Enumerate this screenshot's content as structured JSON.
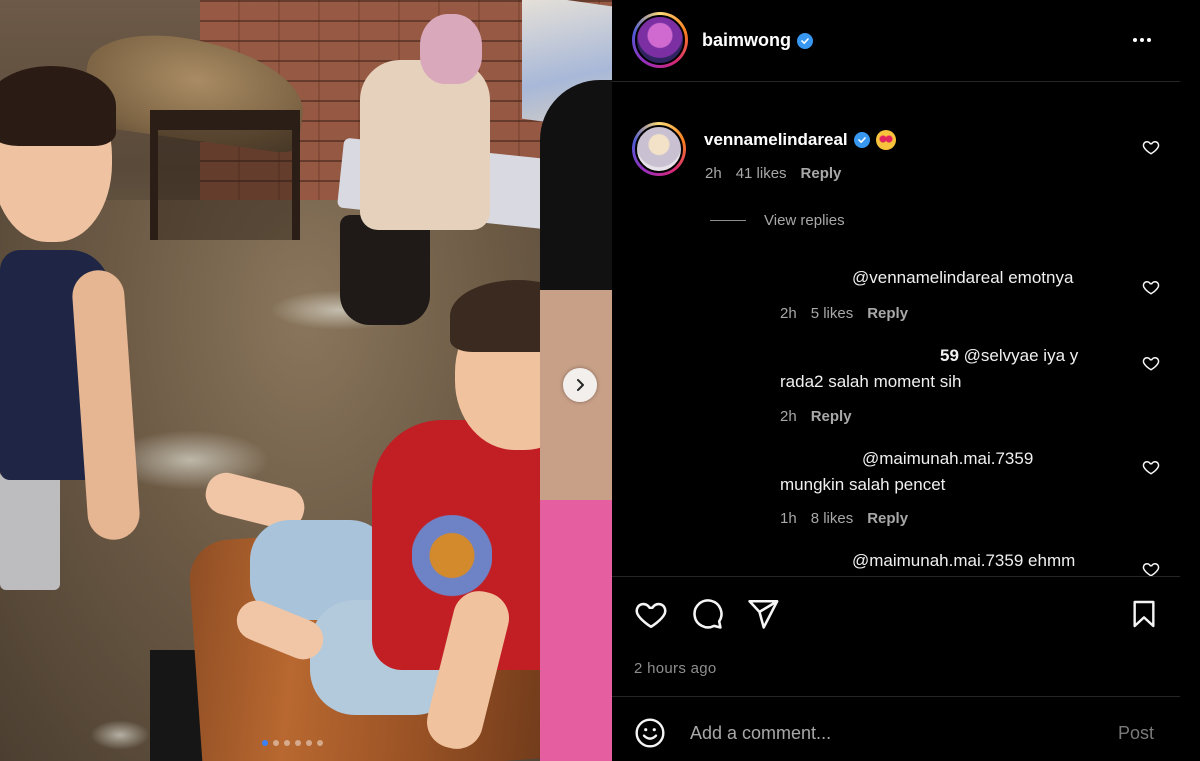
{
  "post": {
    "author": "baimwong",
    "more_icon": "more-horizontal-icon",
    "photo": {
      "carousel_slides": 6,
      "active_slide": 1
    }
  },
  "comments": {
    "main": {
      "username": "vennamelindareal",
      "emoji_icon": "smiling-heart-eyes-emoji",
      "time": "2h",
      "likes": "41 likes",
      "reply": "Reply"
    },
    "view_replies": "View replies",
    "replies": [
      {
        "mention": "@vennamelindareal",
        "text": "emotnya",
        "time": "2h",
        "likes": "5 likes",
        "reply": "Reply"
      },
      {
        "prefix": "59",
        "mention": "@selvyae",
        "text": "iya y",
        "line2": "rada2 salah moment sih",
        "time": "2h",
        "reply": "Reply"
      },
      {
        "mention": "@maimunah.mai.7359",
        "line2": "mungkin salah pencet",
        "time": "1h",
        "likes": "8 likes",
        "reply": "Reply"
      },
      {
        "mention": "@maimunah.mai.7359",
        "text": "ehmm"
      }
    ]
  },
  "actions": {
    "like_icon": "heart-icon",
    "comment_icon": "comment-icon",
    "share_icon": "send-icon",
    "save_icon": "bookmark-icon",
    "timestamp": "2 hours ago"
  },
  "composer": {
    "emoji_icon": "smiley-icon",
    "placeholder": "Add a comment...",
    "post_label": "Post"
  },
  "colors": {
    "background": "#000000",
    "verified": "#3897f0",
    "muted_text": "#a8a8a8",
    "divider": "#262626"
  }
}
